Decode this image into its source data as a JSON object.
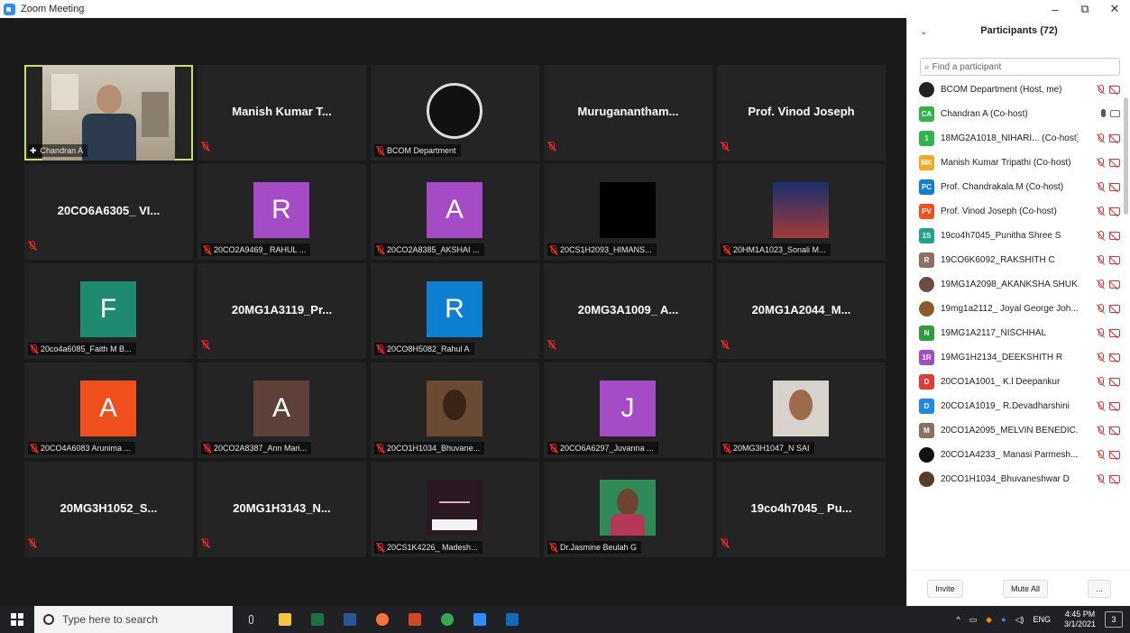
{
  "window": {
    "title": "Zoom Meeting",
    "minimize": "–",
    "restore": "⧉",
    "close": "✕"
  },
  "grid": {
    "tiles": [
      {
        "label": "Chandran A",
        "type": "video"
      },
      {
        "center": "Manish Kumar T...",
        "type": "name"
      },
      {
        "label": "BCOM Department",
        "type": "logo"
      },
      {
        "center": "Muruganantham...",
        "type": "name"
      },
      {
        "center": "Prof. Vinod Joseph",
        "type": "name"
      },
      {
        "center": "20CO6A6305_ VI...",
        "type": "name"
      },
      {
        "label": "20CO2A9469_ RAHUL ...",
        "type": "avatar",
        "letter": "R",
        "color": "#a64bc6"
      },
      {
        "label": "20CO2A8385_AKSHAI ...",
        "type": "avatar",
        "letter": "A",
        "color": "#a64bc6"
      },
      {
        "label": "20CS1H2093_HIMANS...",
        "type": "black"
      },
      {
        "label": "20HM1A1023_Sonali M...",
        "type": "poster"
      },
      {
        "label": "20co4a6085_Faith M B...",
        "type": "avatar",
        "letter": "F",
        "color": "#1f8a70"
      },
      {
        "center": "20MG1A3119_Pr...",
        "type": "name"
      },
      {
        "label": "20CO8H5082_Rahul A",
        "type": "avatar",
        "letter": "R",
        "color": "#0e7fd1"
      },
      {
        "center": "20MG3A1009_ A...",
        "type": "name"
      },
      {
        "center": "20MG1A2044_M...",
        "type": "name"
      },
      {
        "label": "20CO4A6083 Arunima ...",
        "type": "avatar",
        "letter": "A",
        "color": "#f0511c"
      },
      {
        "label": "20CO2A8387_Ann Mari...",
        "type": "avatar",
        "letter": "A",
        "color": "#5d4037"
      },
      {
        "label": "20CO1H1034_Bhuvane...",
        "type": "face"
      },
      {
        "label": "20CO6A6297_Juvanna ...",
        "type": "avatar",
        "letter": "J",
        "color": "#a64bc6"
      },
      {
        "label": "20MG3H1047_N SAI",
        "type": "face2"
      },
      {
        "center": "20MG3H1052_S...",
        "type": "name"
      },
      {
        "center": "20MG1H3143_N...",
        "type": "name"
      },
      {
        "label": "20CS1K4226_ Madesh...",
        "type": "crown"
      },
      {
        "label": "Dr.Jasmine Beulah G",
        "type": "portrait"
      },
      {
        "center": "19co4h7045_ Pu...",
        "type": "name"
      }
    ]
  },
  "participants": {
    "header": "Participants (72)",
    "search_placeholder": "Find a participant",
    "items": [
      {
        "avatar": "",
        "color": "#222222",
        "name": "BCOM Department (Host, me)",
        "muted": true
      },
      {
        "avatar": "CA",
        "color": "#2fb44b",
        "name": "Chandran A (Co-host)",
        "muted": false
      },
      {
        "avatar": "1",
        "color": "#2fb44b",
        "name": "18MG2A1018_NIHARI... (Co-host)",
        "muted": true
      },
      {
        "avatar": "MK",
        "color": "#f5a623",
        "name": "Manish Kumar Tripathi (Co-host)",
        "muted": true
      },
      {
        "avatar": "PC",
        "color": "#0e7fd1",
        "name": "Prof. Chandrakala.M (Co-host)",
        "muted": true
      },
      {
        "avatar": "PV",
        "color": "#f0511c",
        "name": "Prof. Vinod Joseph (Co-host)",
        "muted": true
      },
      {
        "avatar": "1S",
        "color": "#1fa38a",
        "name": "19co4h7045_Punitha Shree S",
        "muted": true
      },
      {
        "avatar": "R",
        "color": "#8d6e63",
        "name": "19CO6K6092_RAKSHITH C",
        "muted": true
      },
      {
        "avatar": "",
        "color": "#6d4c41",
        "name": "19MG1A2098_AKANKSHA SHUK...",
        "muted": true
      },
      {
        "avatar": "",
        "color": "#8a5a2b",
        "name": "19mg1a2112_ Joyal George Joh...",
        "muted": true
      },
      {
        "avatar": "N",
        "color": "#2e9c3f",
        "name": "19MG1A2117_NISCHHAL",
        "muted": true
      },
      {
        "avatar": "1R",
        "color": "#a64bc6",
        "name": "19MG1H2134_DEEKSHITH R",
        "muted": true
      },
      {
        "avatar": "D",
        "color": "#e53935",
        "name": "20CO1A1001_ K.l Deepankur",
        "muted": true
      },
      {
        "avatar": "D",
        "color": "#1e88e5",
        "name": "20CO1A1019_ R.Devadharshini",
        "muted": true
      },
      {
        "avatar": "M",
        "color": "#8d6e63",
        "name": "20CO1A2095_MELVIN BENEDIC...",
        "muted": true
      },
      {
        "avatar": "",
        "color": "#111111",
        "name": "20CO1A4233_ Manasi Parmesh...",
        "muted": true
      },
      {
        "avatar": "",
        "color": "#5a3a22",
        "name": "20CO1H1034_Bhuvaneshwar D",
        "muted": true
      }
    ],
    "invite": "Invite",
    "mute_all": "Mute All",
    "more": "..."
  },
  "taskbar": {
    "search_placeholder": "Type here to search",
    "apps": [
      {
        "name": "file-explorer",
        "color": "#f5c542"
      },
      {
        "name": "excel",
        "color": "#1e7145"
      },
      {
        "name": "word",
        "color": "#2b579a"
      },
      {
        "name": "firefox",
        "color": "#ff7139"
      },
      {
        "name": "powerpoint",
        "color": "#d24726"
      },
      {
        "name": "chrome",
        "color": "#34a853"
      },
      {
        "name": "zoom",
        "color": "#2d8cff"
      },
      {
        "name": "photos",
        "color": "#0f6cbd"
      }
    ],
    "lang": "ENG",
    "time": "4:45 PM",
    "date": "3/1/2021",
    "notif": "3"
  }
}
